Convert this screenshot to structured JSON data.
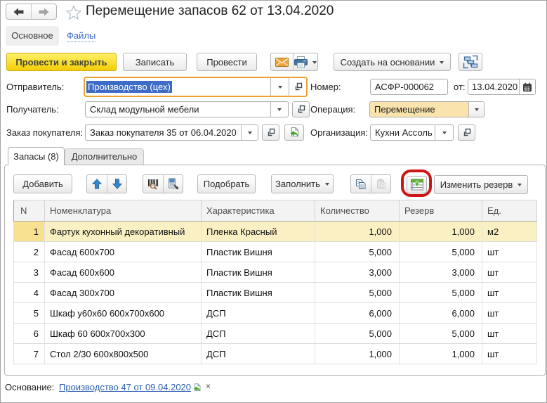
{
  "header": {
    "title": "Перемещение запасов 62 от 13.04.2020",
    "nav_main": "Основное",
    "nav_files": "Файлы"
  },
  "commands": {
    "post_and_close": "Провести и закрыть",
    "write": "Записать",
    "post": "Провести",
    "create_based_on": "Создать на основании"
  },
  "form": {
    "sender_label": "Отправитель:",
    "sender_value": "Производство (цех)",
    "receiver_label": "Получатель:",
    "receiver_value": "Склад модульной мебели",
    "order_label": "Заказ покупателя:",
    "order_value": "Заказ покупателя 35 от 06.04.2020",
    "number_label": "Номер:",
    "number_value": "АСФР-000062",
    "date_label": "от:",
    "date_value": "13.04.2020",
    "operation_label": "Операция:",
    "operation_value": "Перемещение",
    "organization_label": "Организация:",
    "organization_value": "Кухни Ассоль"
  },
  "tabs": {
    "inventory": "Запасы (8)",
    "additional": "Дополнительно"
  },
  "toolbar": {
    "add": "Добавить",
    "pick": "Подобрать",
    "fill": "Заполнить",
    "change_reserve": "Изменить резерв"
  },
  "table": {
    "columns": [
      "N",
      "Номенклатура",
      "Характеристика",
      "Количество",
      "Резерв",
      "Ед."
    ],
    "rows": [
      [
        "1",
        "Фартук кухонный декоративный",
        "Пленка Красный",
        "1,000",
        "1,000",
        "м2"
      ],
      [
        "2",
        "Фасад 600х700",
        "Пластик Вишня",
        "5,000",
        "5,000",
        "шт"
      ],
      [
        "3",
        "Фасад 600х600",
        "Пластик Вишня",
        "3,000",
        "3,000",
        "шт"
      ],
      [
        "4",
        "Фасад 300х700",
        "Пластик Вишня",
        "5,000",
        "5,000",
        "шт"
      ],
      [
        "5",
        "Шкаф у60х60 600х700х600",
        "ДСП",
        "6,000",
        "6,000",
        "шт"
      ],
      [
        "6",
        "Шкаф 60 600х700х300",
        "ДСП",
        "5,000",
        "5,000",
        "шт"
      ],
      [
        "7",
        "Стол 2/30 600х800х500",
        "ДСП",
        "1,000",
        "1,000",
        "шт"
      ]
    ],
    "selected_row": 1
  },
  "footer": {
    "basis_label": "Основание:",
    "basis_link": "Производство 47 от 09.04.2020",
    "close_symbol": "×"
  },
  "colors": {
    "accent_yellow": "#F3CD07",
    "focus_border": "#ECA431",
    "selection_blue": "#3D6BC8",
    "selected_row_bg": "#FBF0C4",
    "operation_bg": "#FAE3AD",
    "link_blue": "#2A5DB0",
    "annotation_red": "#CF1414"
  }
}
